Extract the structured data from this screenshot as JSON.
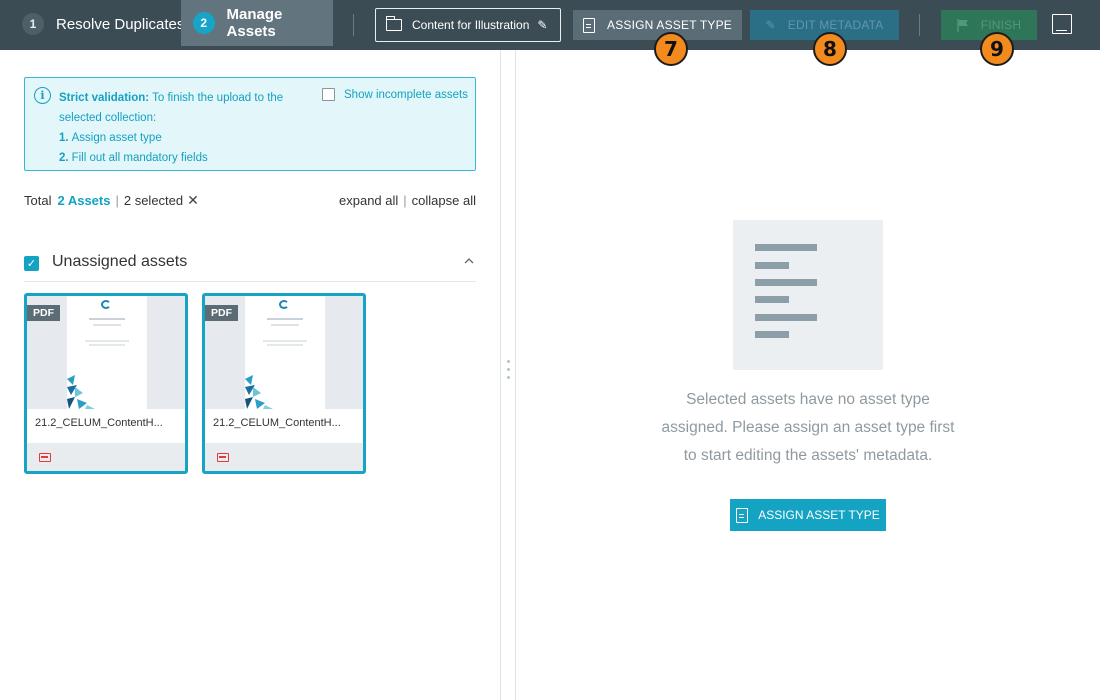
{
  "steps": [
    {
      "number": "1",
      "label": "Resolve Duplicates"
    },
    {
      "number": "2",
      "label": "Manage Assets"
    }
  ],
  "toolbar": {
    "collection_label": "Content for Illustration",
    "assign_label": "ASSIGN ASSET TYPE",
    "edit_label": "EDIT METADATA",
    "finish_label": "FINISH"
  },
  "badges": {
    "assign": "7",
    "edit": "8",
    "finish": "9"
  },
  "validation": {
    "title": "Strict validation:",
    "message": "To finish the upload to the selected collection:",
    "steps": [
      {
        "num": "1.",
        "text": "Assign asset type"
      },
      {
        "num": "2.",
        "text": "Fill out all mandatory fields"
      }
    ],
    "show_incomplete_label": "Show incomplete assets"
  },
  "summary": {
    "total_label": "Total",
    "count": "2 Assets",
    "separator": "|",
    "selected": "2 selected",
    "clear_icon": "✕",
    "expand_all": "expand all",
    "collapse_all": "collapse all"
  },
  "group": {
    "title": "Unassigned assets",
    "checked_icon": "✓",
    "chevron": "^"
  },
  "assets": [
    {
      "type": "PDF",
      "name": "21.2_CELUM_ContentH..."
    },
    {
      "type": "PDF",
      "name": "21.2_CELUM_ContentH..."
    }
  ],
  "empty_state": {
    "lines": [
      "Selected assets have no asset type",
      "assigned. Please assign an asset type first",
      "to start editing the assets' metadata."
    ],
    "button_label": "ASSIGN ASSET TYPE"
  },
  "colors": {
    "topbar": "#3b4c55",
    "accent": "#15a3c4",
    "badge": "#f28a1e",
    "edit_button": "#2b6f86",
    "finish_button": "#2f7557"
  }
}
